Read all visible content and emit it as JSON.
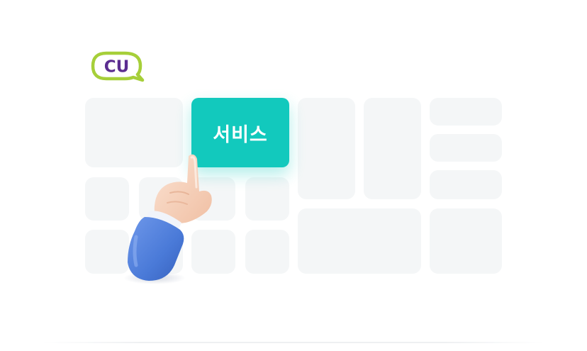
{
  "brand": {
    "logo_text": "CU",
    "colors": {
      "logo_purple": "#5b2d90",
      "logo_green": "#a6cf39"
    }
  },
  "service_button": {
    "label": "서비스",
    "color": "#12c9bd"
  },
  "illustration": {
    "icon": "pointing-hand-icon",
    "sleeve_color": "#4a7ad8",
    "tile_color": "#f4f6f7"
  }
}
